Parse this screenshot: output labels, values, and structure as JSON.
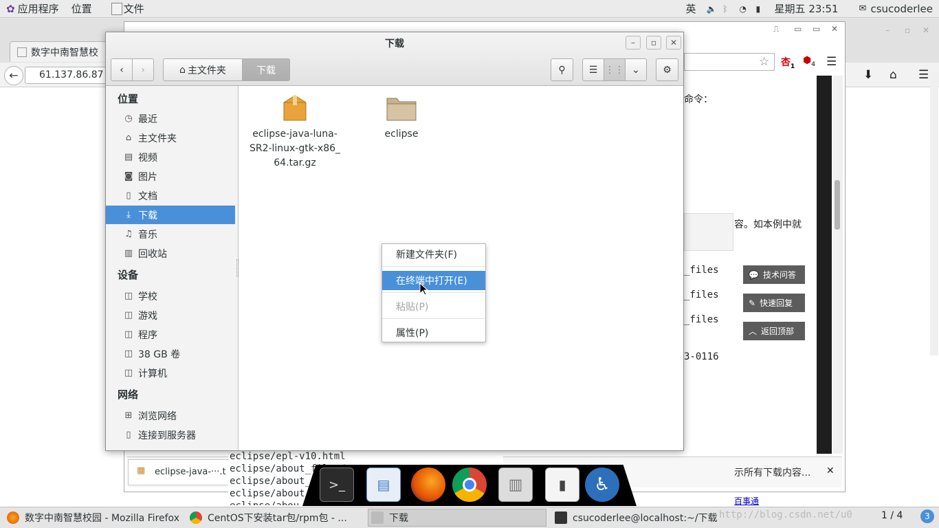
{
  "topbar": {
    "apps_label": "应用程序",
    "places_label": "位置",
    "files_label": "文件",
    "ime_label": "英",
    "clock": "星期五 23:51",
    "user": "csucoderlee"
  },
  "browser": {
    "tab_title": "数字中南智慧校",
    "url": "61.137.86.87",
    "badge_a": "1",
    "badge_b": "4",
    "page_text_1": "命令：",
    "page_text_2": "容。如本例中就",
    "files_1": "_files",
    "files_2": "_files",
    "files_3": "_files",
    "num_text": "3-0116",
    "side_buttons": [
      "技术问答",
      "快速回复",
      "返回顶部"
    ],
    "download_item": "eclipse-java-···.t",
    "show_all_downloads": "示所有下载内容...",
    "baidu_link": "百事通",
    "page_counter": "1 / 4"
  },
  "terminal_lines": [
    "eclipse/epl-v10.html",
    "eclipse/about_files/",
    "eclipse/about_files/IJG_README",
    "eclipse/about",
    "eclipse/abou"
  ],
  "nautilus": {
    "title": "下载",
    "path_home": "主文件夹",
    "path_current": "下载",
    "sidebar": {
      "places_header": "位置",
      "places": [
        {
          "label": "最近",
          "icon": "clock-icon"
        },
        {
          "label": "主文件夹",
          "icon": "home-icon"
        },
        {
          "label": "视频",
          "icon": "film-icon"
        },
        {
          "label": "图片",
          "icon": "camera-icon"
        },
        {
          "label": "文档",
          "icon": "document-icon"
        },
        {
          "label": "下载",
          "icon": "download-icon"
        },
        {
          "label": "音乐",
          "icon": "music-icon"
        },
        {
          "label": "回收站",
          "icon": "trash-icon"
        }
      ],
      "devices_header": "设备",
      "devices": [
        {
          "label": "学校",
          "icon": "drive-icon"
        },
        {
          "label": "游戏",
          "icon": "drive-icon"
        },
        {
          "label": "程序",
          "icon": "drive-icon"
        },
        {
          "label": "38 GB 卷",
          "icon": "drive-icon"
        },
        {
          "label": "计算机",
          "icon": "drive-icon"
        }
      ],
      "network_header": "网络",
      "network": [
        {
          "label": "浏览网络",
          "icon": "network-icon"
        },
        {
          "label": "连接到服务器",
          "icon": "server-icon"
        }
      ]
    },
    "files": [
      {
        "name_line1": "eclipse-java-luna-",
        "name_line2": "SR2-linux-gtk-x86_",
        "name_line3": "64.tar.gz",
        "icon": "archive-icon"
      },
      {
        "name_line1": "eclipse",
        "icon": "folder-icon"
      }
    ]
  },
  "context_menu": {
    "new_folder": "新建文件夹(F)",
    "open_terminal": "在终端中打开(E)",
    "paste": "粘贴(P)",
    "properties": "属性(P)"
  },
  "taskbar": {
    "items": [
      "数字中南智慧校园 - Mozilla Firefox",
      "CentOS下安装tar包/rpm包 - ...",
      "下载",
      "csucoderlee@localhost:~/下载"
    ],
    "watermark": "http://blog.csdn.net/u0",
    "workspace_number": "3"
  },
  "colors": {
    "selection": "#4a90d9",
    "side_button": "#5c5c5c"
  }
}
